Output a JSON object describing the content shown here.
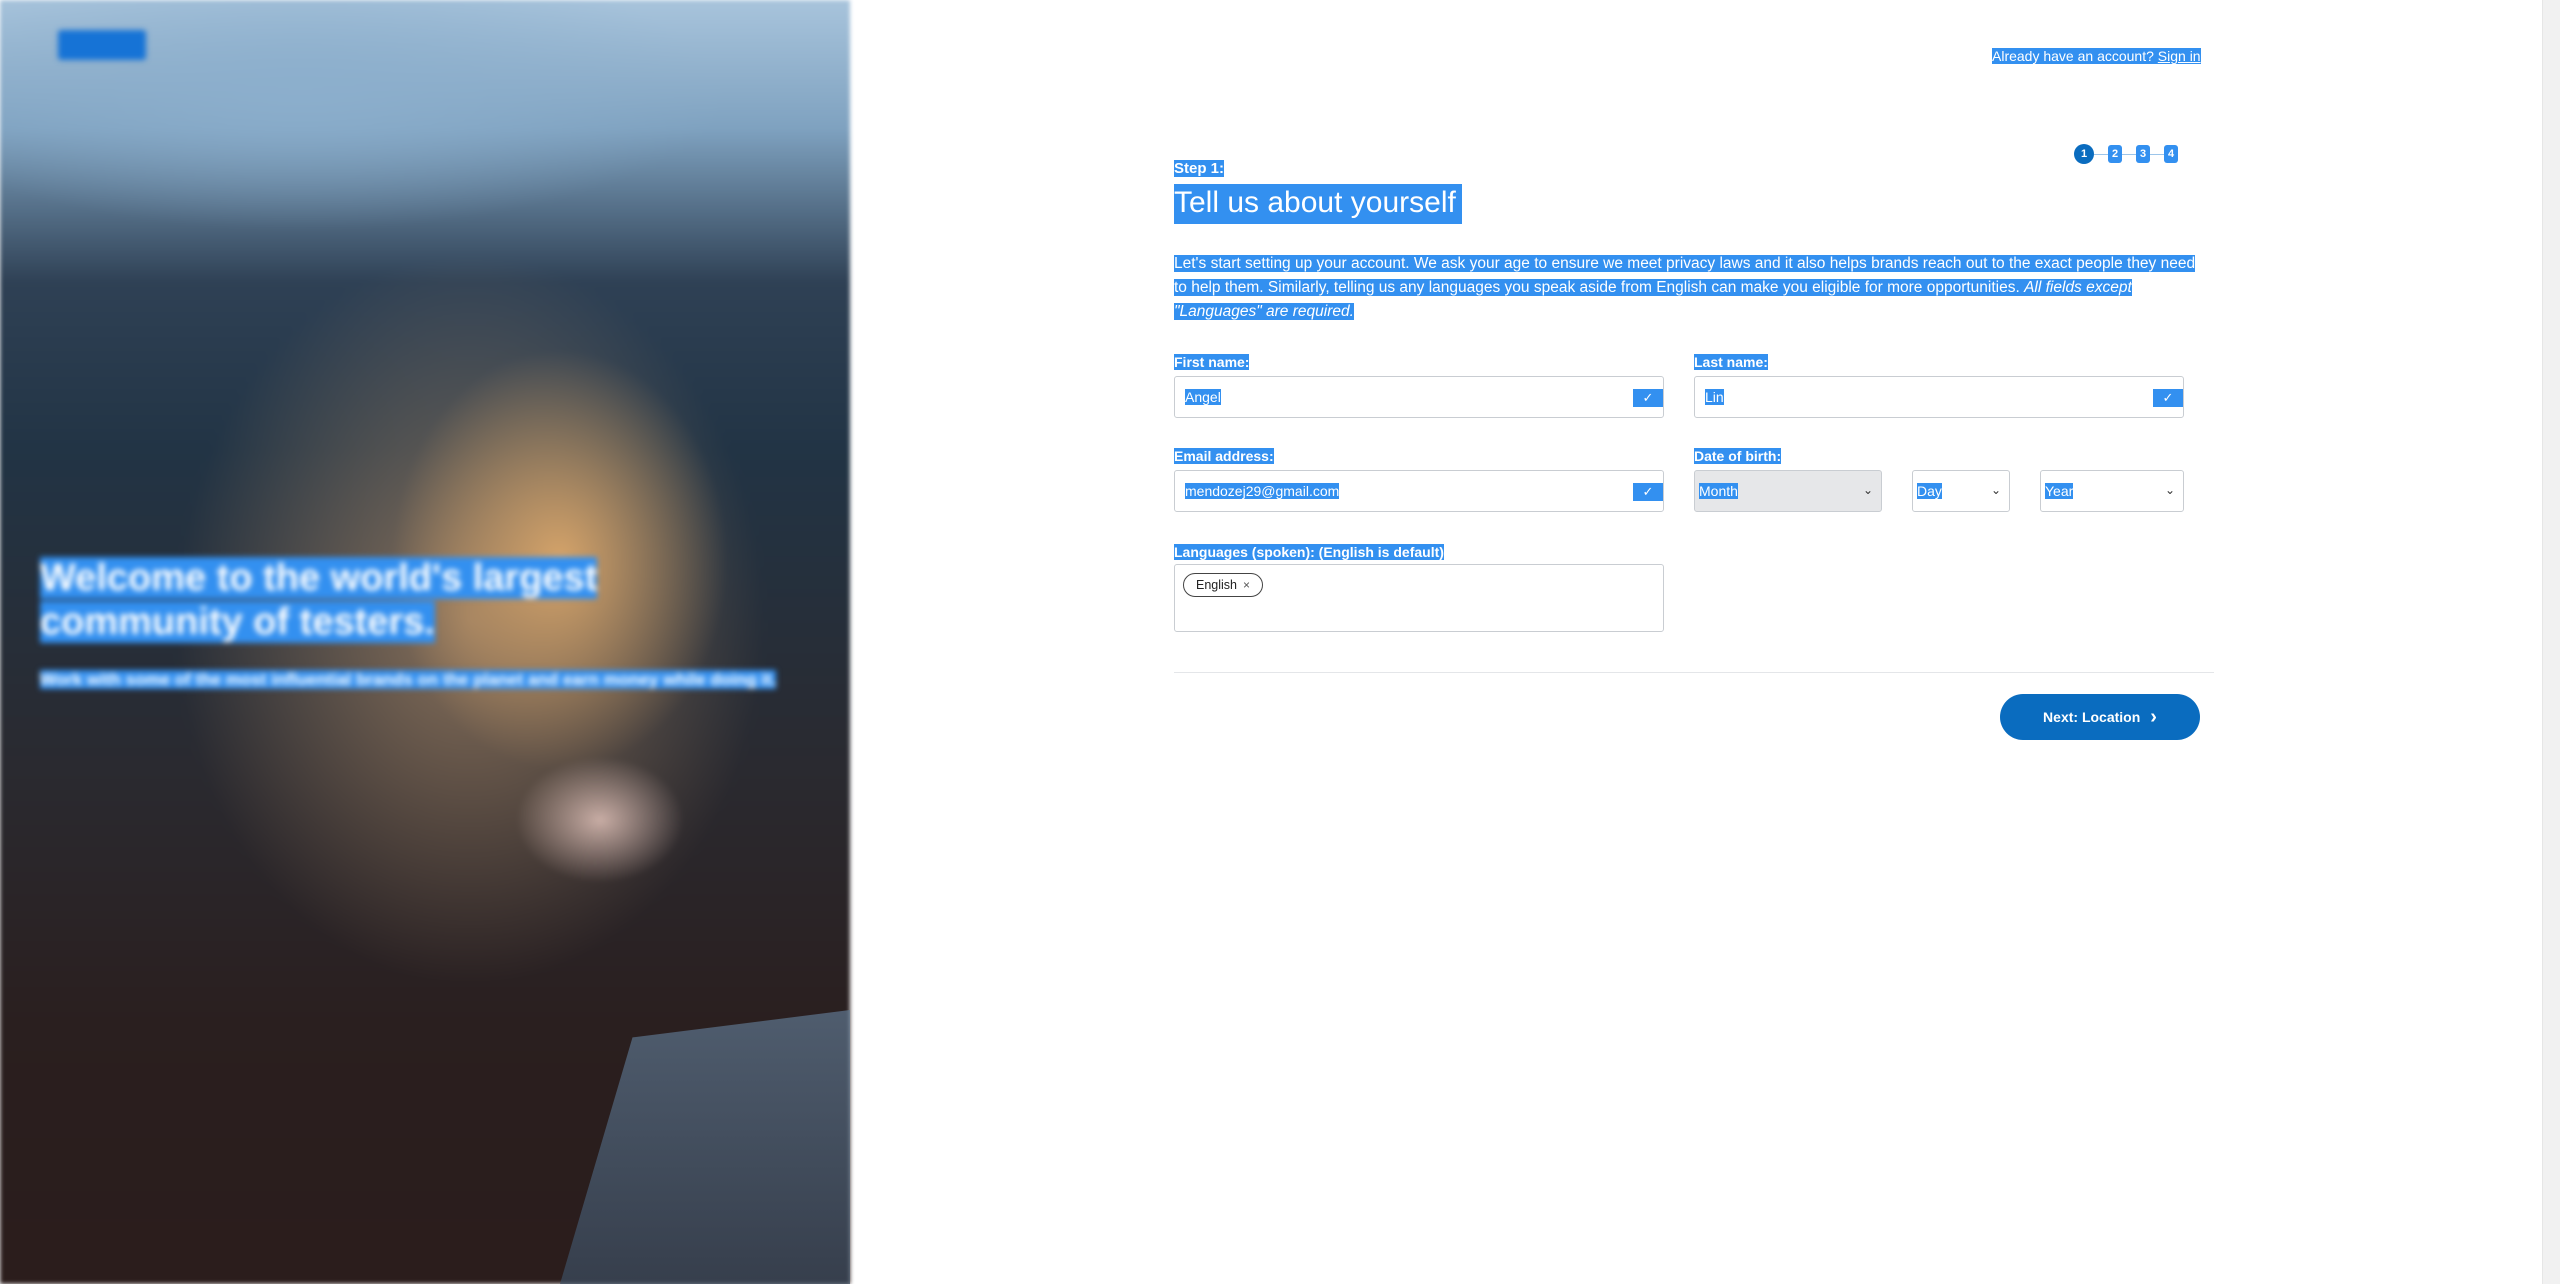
{
  "hero": {
    "title": "Welcome to the world's largest community of testers.",
    "subtitle": "Work with some of the most influential brands on the planet and earn money while doing it."
  },
  "header": {
    "prompt": "Already have an account?",
    "signin_label": "Sign in"
  },
  "steps": [
    "1",
    "2",
    "3",
    "4"
  ],
  "form": {
    "step_label": "Step 1:",
    "title": "Tell us about yourself",
    "intro_text": "Let's start setting up your account. We ask your age to ensure we meet privacy laws and it also helps brands reach out to the exact people they need to help them. Similarly, telling us any languages you speak aside from English can make you eligible for more opportunities.",
    "intro_emphasis": "All fields except \"Languages\" are required.",
    "first_name_label": "First name:",
    "first_name_value": "Angel",
    "last_name_label": "Last name:",
    "last_name_value": "Lin",
    "email_label": "Email address:",
    "email_value": "mendozej29@gmail.com",
    "dob_label": "Date of birth:",
    "dob_month": "Month",
    "dob_day": "Day",
    "dob_year": "Year",
    "languages_label": "Languages (spoken): (English is default)",
    "language_tag": "English",
    "tag_remove": "×"
  },
  "footer": {
    "next_label": "Next: Location"
  },
  "icons": {
    "check": "✓",
    "chevron_down": "⌄",
    "chevron_right": "›"
  },
  "colors": {
    "primary": "#0a6cbf",
    "selection": "#3390f0"
  }
}
